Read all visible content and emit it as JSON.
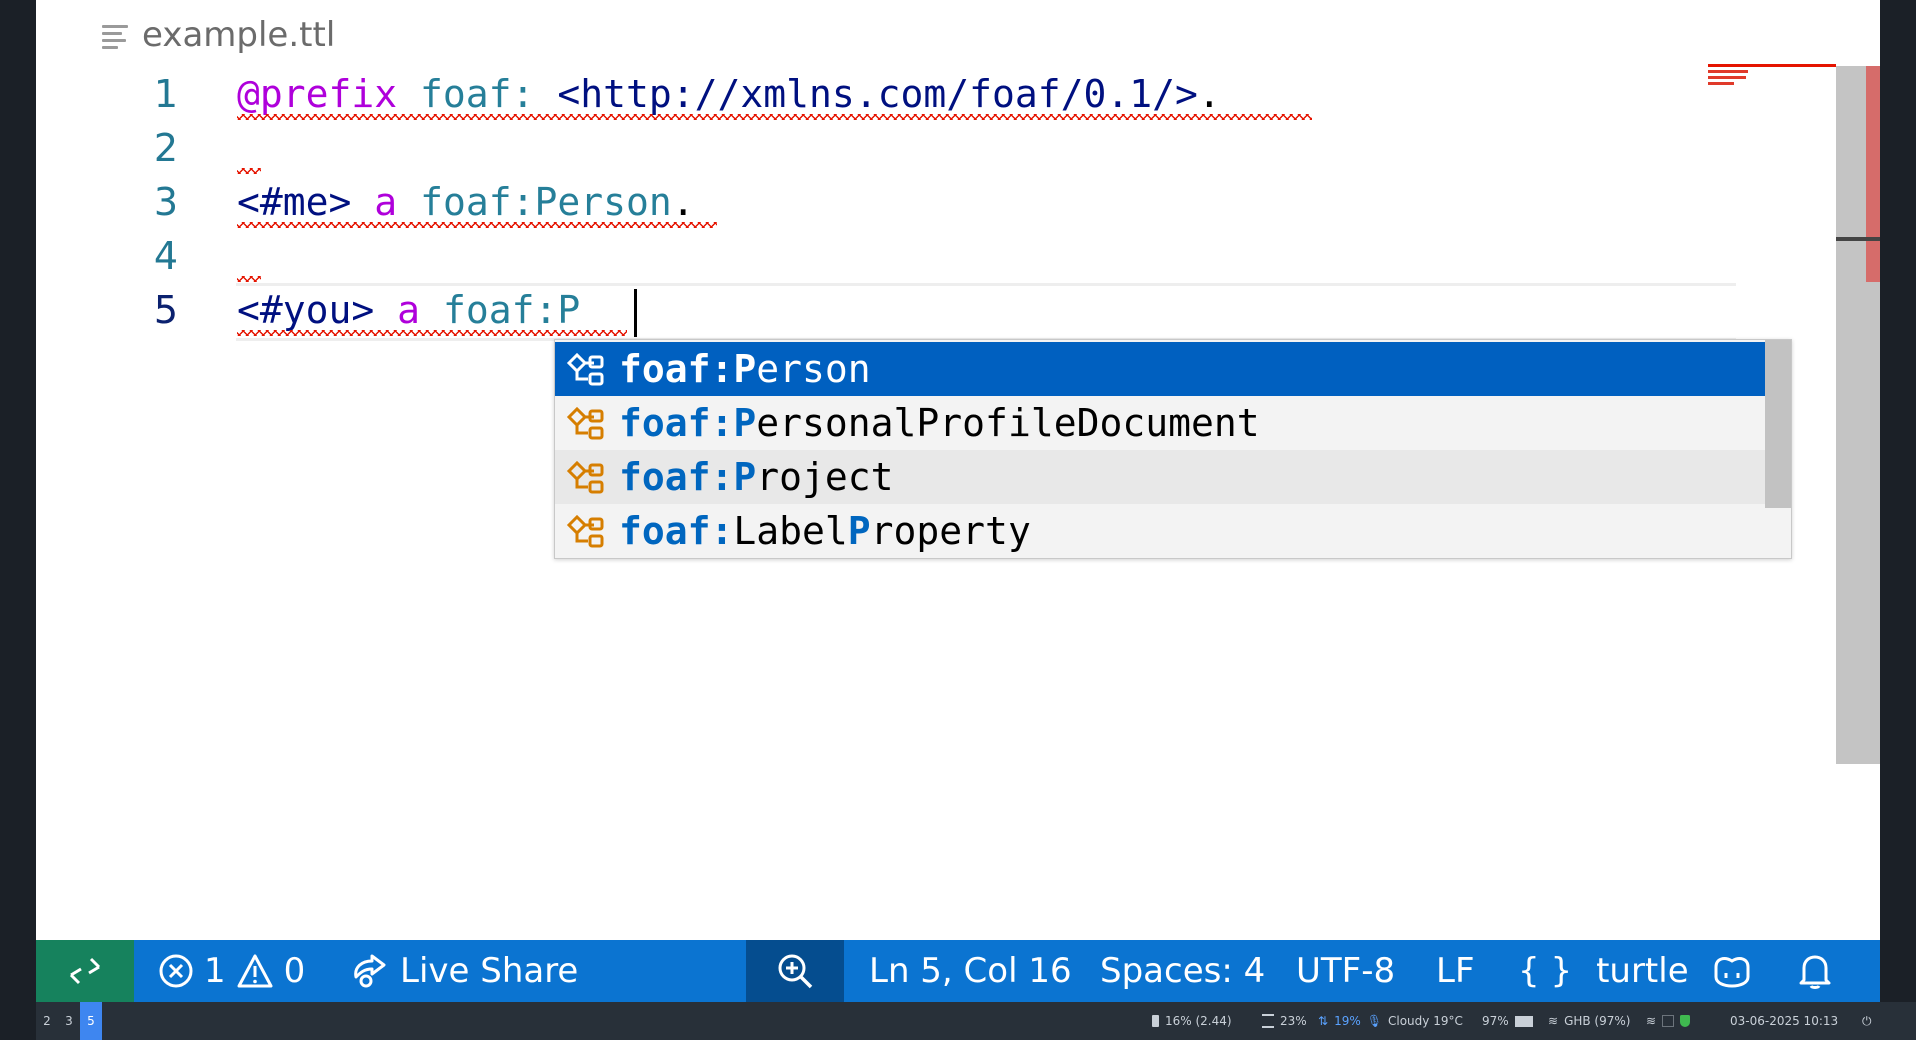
{
  "editor": {
    "filename": "example.ttl",
    "line_numbers": [
      "1",
      "2",
      "3",
      "4",
      "5"
    ],
    "lines": [
      {
        "prefix_kw": "@prefix",
        "prefix_name": "foaf:",
        "iri": "<http://xmlns.com/foaf/0.1/>",
        "end": "."
      },
      {},
      {
        "subject": "<#me>",
        "predicate": "a",
        "object": "foaf:Person",
        "end": "."
      },
      {},
      {
        "subject": "<#you>",
        "predicate": "a",
        "object_typed": "foaf:P"
      }
    ]
  },
  "suggestions": [
    {
      "match": "foaf:P",
      "rest": "erson",
      "selected": true
    },
    {
      "match": "foaf:P",
      "rest": "ersonalProfileDocument"
    },
    {
      "match": "foaf:P",
      "rest": "roject"
    },
    {
      "match": "foaf:",
      "mid": "Label",
      "match2": "P",
      "rest": "roperty"
    }
  ],
  "statusbar": {
    "errors": "1",
    "warnings": "0",
    "live_share": "Live Share",
    "position": "Ln 5, Col 16",
    "spaces": "Spaces: 4",
    "encoding": "UTF-8",
    "eol": "LF",
    "language_icon": "{ }",
    "language": "turtle",
    "colors": {
      "background": "#0b74d1",
      "remote": "#16825d"
    }
  },
  "taskbar": {
    "workspaces": [
      "2",
      "3",
      "5"
    ],
    "active_workspace": "5",
    "cpu": "16% (2.44)",
    "mem": "23%",
    "net": "19%",
    "weather": "Cloudy 19°C",
    "battery": "97%",
    "wifi": "GHB (97%)",
    "datetime": "03-06-2025 10:13"
  }
}
